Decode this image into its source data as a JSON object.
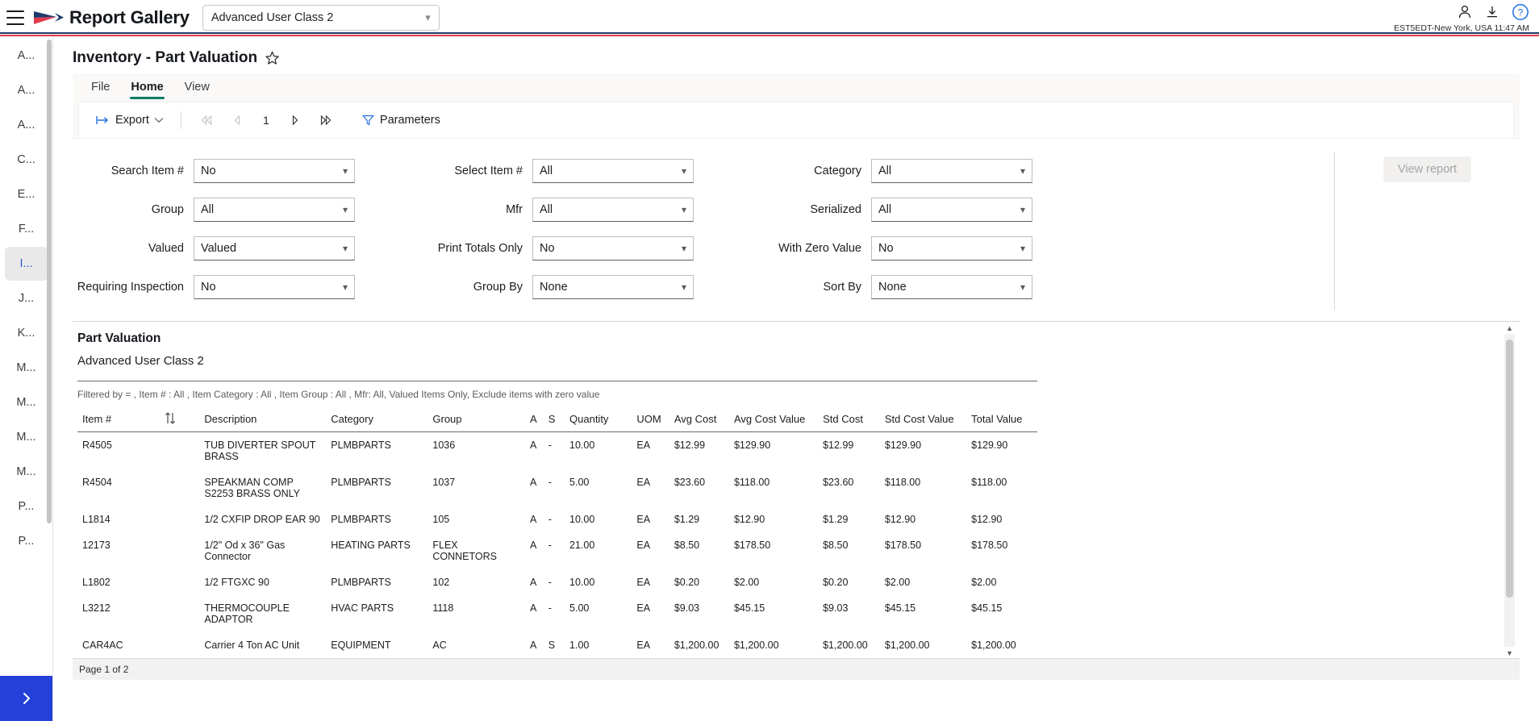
{
  "header": {
    "menu_icon": "hamburger-icon",
    "logo_icon": "arrow-logo-icon",
    "title": "Report Gallery",
    "class_select": {
      "value": "Advanced User Class 2",
      "chevron": "chevron-down-icon"
    },
    "icons": [
      "person-icon",
      "download-icon",
      "help-icon"
    ],
    "timezone": "EST5EDT-New York, USA 11:47 AM"
  },
  "sidebar": {
    "items": [
      {
        "label": "A...",
        "active": false
      },
      {
        "label": "A...",
        "active": false
      },
      {
        "label": "A...",
        "active": false
      },
      {
        "label": "C...",
        "active": false
      },
      {
        "label": "E...",
        "active": false
      },
      {
        "label": "F...",
        "active": false
      },
      {
        "label": "I...",
        "active": true
      },
      {
        "label": "J...",
        "active": false
      },
      {
        "label": "K...",
        "active": false
      },
      {
        "label": "M...",
        "active": false
      },
      {
        "label": "M...",
        "active": false
      },
      {
        "label": "M...",
        "active": false
      },
      {
        "label": "M...",
        "active": false
      },
      {
        "label": "P...",
        "active": false
      },
      {
        "label": "P...",
        "active": false
      }
    ],
    "expand_label": "›",
    "expand_icon": "chevron-right-icon"
  },
  "page": {
    "title": "Inventory - Part Valuation",
    "favorite_icon": "star-icon"
  },
  "ribbon": {
    "tabs": [
      {
        "label": "File",
        "active": false
      },
      {
        "label": "Home",
        "active": true
      },
      {
        "label": "View",
        "active": false
      }
    ],
    "toolbar": {
      "export_label": "Export",
      "export_icon": "export-arrow-icon",
      "export_chevron": "chevron-down-icon",
      "first_page_icon": "first-page-icon",
      "prev_page_icon": "prev-page-icon",
      "page_number": "1",
      "next_page_icon": "next-page-icon",
      "last_page_icon": "last-page-icon",
      "parameters_label": "Parameters",
      "parameters_icon": "filter-funnel-icon"
    }
  },
  "filters": {
    "column1": [
      {
        "label": "Search Item #",
        "value": "No",
        "highlight": true
      },
      {
        "label": "Group",
        "value": "All",
        "highlight": false
      },
      {
        "label": "Valued",
        "value": "Valued",
        "highlight": false
      },
      {
        "label": "Requiring Inspection",
        "value": "No",
        "highlight": false
      }
    ],
    "column2": [
      {
        "label": "Select Item #",
        "value": "All",
        "highlight": true
      },
      {
        "label": "Mfr",
        "value": "All",
        "highlight": false
      },
      {
        "label": "Print Totals Only",
        "value": "No",
        "highlight": false
      },
      {
        "label": "Group By",
        "value": "None",
        "highlight": false
      }
    ],
    "column3": [
      {
        "label": "Category",
        "value": "All",
        "highlight": false
      },
      {
        "label": "Serialized",
        "value": "All",
        "highlight": false
      },
      {
        "label": "With Zero Value",
        "value": "No",
        "highlight": false
      },
      {
        "label": "Sort By",
        "value": "None",
        "highlight": false
      }
    ],
    "view_report_label": "View report"
  },
  "report": {
    "title": "Part Valuation",
    "subtitle": "Advanced User Class 2",
    "filtered_by": "Filtered by = , Item # : All , Item Category : All , Item Group : All , Mfr: All, Valued Items Only, Exclude items with zero value",
    "sort_icon": "sort-arrows-icon",
    "columns": [
      "Item #",
      "",
      "Description",
      "Category",
      "Group",
      "A",
      "S",
      "Quantity",
      "UOM",
      "Avg Cost",
      "Avg Cost Value",
      "Std Cost",
      "Std Cost Value",
      "Total Value"
    ],
    "rows": [
      {
        "item": "R4505",
        "description": "TUB DIVERTER SPOUT BRASS",
        "category": "PLMBPARTS",
        "group": "1036",
        "a": "A",
        "s": "-",
        "quantity": "10.00",
        "uom": "EA",
        "avg_cost": "$12.99",
        "avg_cost_value": "$129.90",
        "std_cost": "$12.99",
        "std_cost_value": "$129.90",
        "total_value": "$129.90"
      },
      {
        "item": "R4504",
        "description": "SPEAKMAN COMP S2253 BRASS ONLY",
        "category": "PLMBPARTS",
        "group": "1037",
        "a": "A",
        "s": "-",
        "quantity": "5.00",
        "uom": "EA",
        "avg_cost": "$23.60",
        "avg_cost_value": "$118.00",
        "std_cost": "$23.60",
        "std_cost_value": "$118.00",
        "total_value": "$118.00"
      },
      {
        "item": "L1814",
        "description": "1/2 CXFIP DROP EAR 90",
        "category": "PLMBPARTS",
        "group": "105",
        "a": "A",
        "s": "-",
        "quantity": "10.00",
        "uom": "EA",
        "avg_cost": "$1.29",
        "avg_cost_value": "$12.90",
        "std_cost": "$1.29",
        "std_cost_value": "$12.90",
        "total_value": "$12.90"
      },
      {
        "item": "12173",
        "description": "1/2\" Od x 36\" Gas Connector",
        "category": "HEATING PARTS",
        "group": "FLEX CONNETORS",
        "a": "A",
        "s": "-",
        "quantity": "21.00",
        "uom": "EA",
        "avg_cost": "$8.50",
        "avg_cost_value": "$178.50",
        "std_cost": "$8.50",
        "std_cost_value": "$178.50",
        "total_value": "$178.50"
      },
      {
        "item": "L1802",
        "description": "1/2 FTGXC 90",
        "category": "PLMBPARTS",
        "group": "102",
        "a": "A",
        "s": "-",
        "quantity": "10.00",
        "uom": "EA",
        "avg_cost": "$0.20",
        "avg_cost_value": "$2.00",
        "std_cost": "$0.20",
        "std_cost_value": "$2.00",
        "total_value": "$2.00"
      },
      {
        "item": "L3212",
        "description": "THERMOCOUPLE ADAPTOR",
        "category": "HVAC PARTS",
        "group": "1118",
        "a": "A",
        "s": "-",
        "quantity": "5.00",
        "uom": "EA",
        "avg_cost": "$9.03",
        "avg_cost_value": "$45.15",
        "std_cost": "$9.03",
        "std_cost_value": "$45.15",
        "total_value": "$45.15"
      },
      {
        "item": "CAR4AC",
        "description": "Carrier 4 Ton AC Unit",
        "category": "EQUIPMENT",
        "group": "AC",
        "a": "A",
        "s": "S",
        "quantity": "1.00",
        "uom": "EA",
        "avg_cost": "$1,200.00",
        "avg_cost_value": "$1,200.00",
        "std_cost": "$1,200.00",
        "std_cost_value": "$1,200.00",
        "total_value": "$1,200.00"
      }
    ]
  },
  "statusbar": {
    "page_info": "Page 1 of 2"
  }
}
